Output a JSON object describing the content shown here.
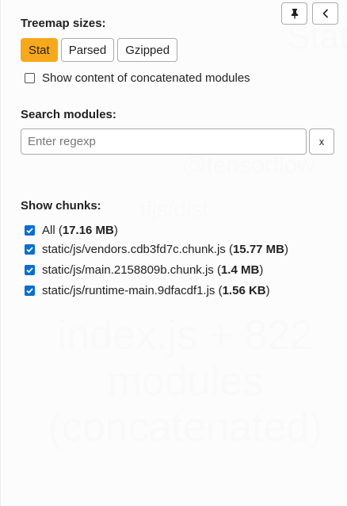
{
  "background": {
    "stat_label": "Stat",
    "tensorflow_label": "@tensorflow",
    "tfjs_label": "tfjs/dist",
    "index_label_lines": [
      "index.js + 822",
      "modules",
      "(concatenated)"
    ]
  },
  "toolbar": {
    "pin_icon": "pin-icon",
    "collapse_icon": "chevron-left-icon"
  },
  "treemap": {
    "title": "Treemap sizes:",
    "buttons": [
      {
        "label": "Stat",
        "active": true
      },
      {
        "label": "Parsed",
        "active": false
      },
      {
        "label": "Gzipped",
        "active": false
      }
    ],
    "concat_label": "Show content of concatenated modules",
    "concat_checked": false
  },
  "search": {
    "title": "Search modules:",
    "placeholder": "Enter regexp",
    "clear_label": "x"
  },
  "chunks": {
    "title": "Show chunks:",
    "items": [
      {
        "name": "All",
        "size": "17.16 MB",
        "checked": true
      },
      {
        "name": "static/js/vendors.cdb3fd7c.chunk.js",
        "size": "15.77 MB",
        "checked": true
      },
      {
        "name": "static/js/main.2158809b.chunk.js",
        "size": "1.4 MB",
        "checked": true
      },
      {
        "name": "static/js/runtime-main.9dfacdf1.js",
        "size": "1.56 KB",
        "checked": true
      }
    ]
  },
  "colors": {
    "accent": "#f7a81b",
    "checkbox": "#0a6ed1"
  }
}
